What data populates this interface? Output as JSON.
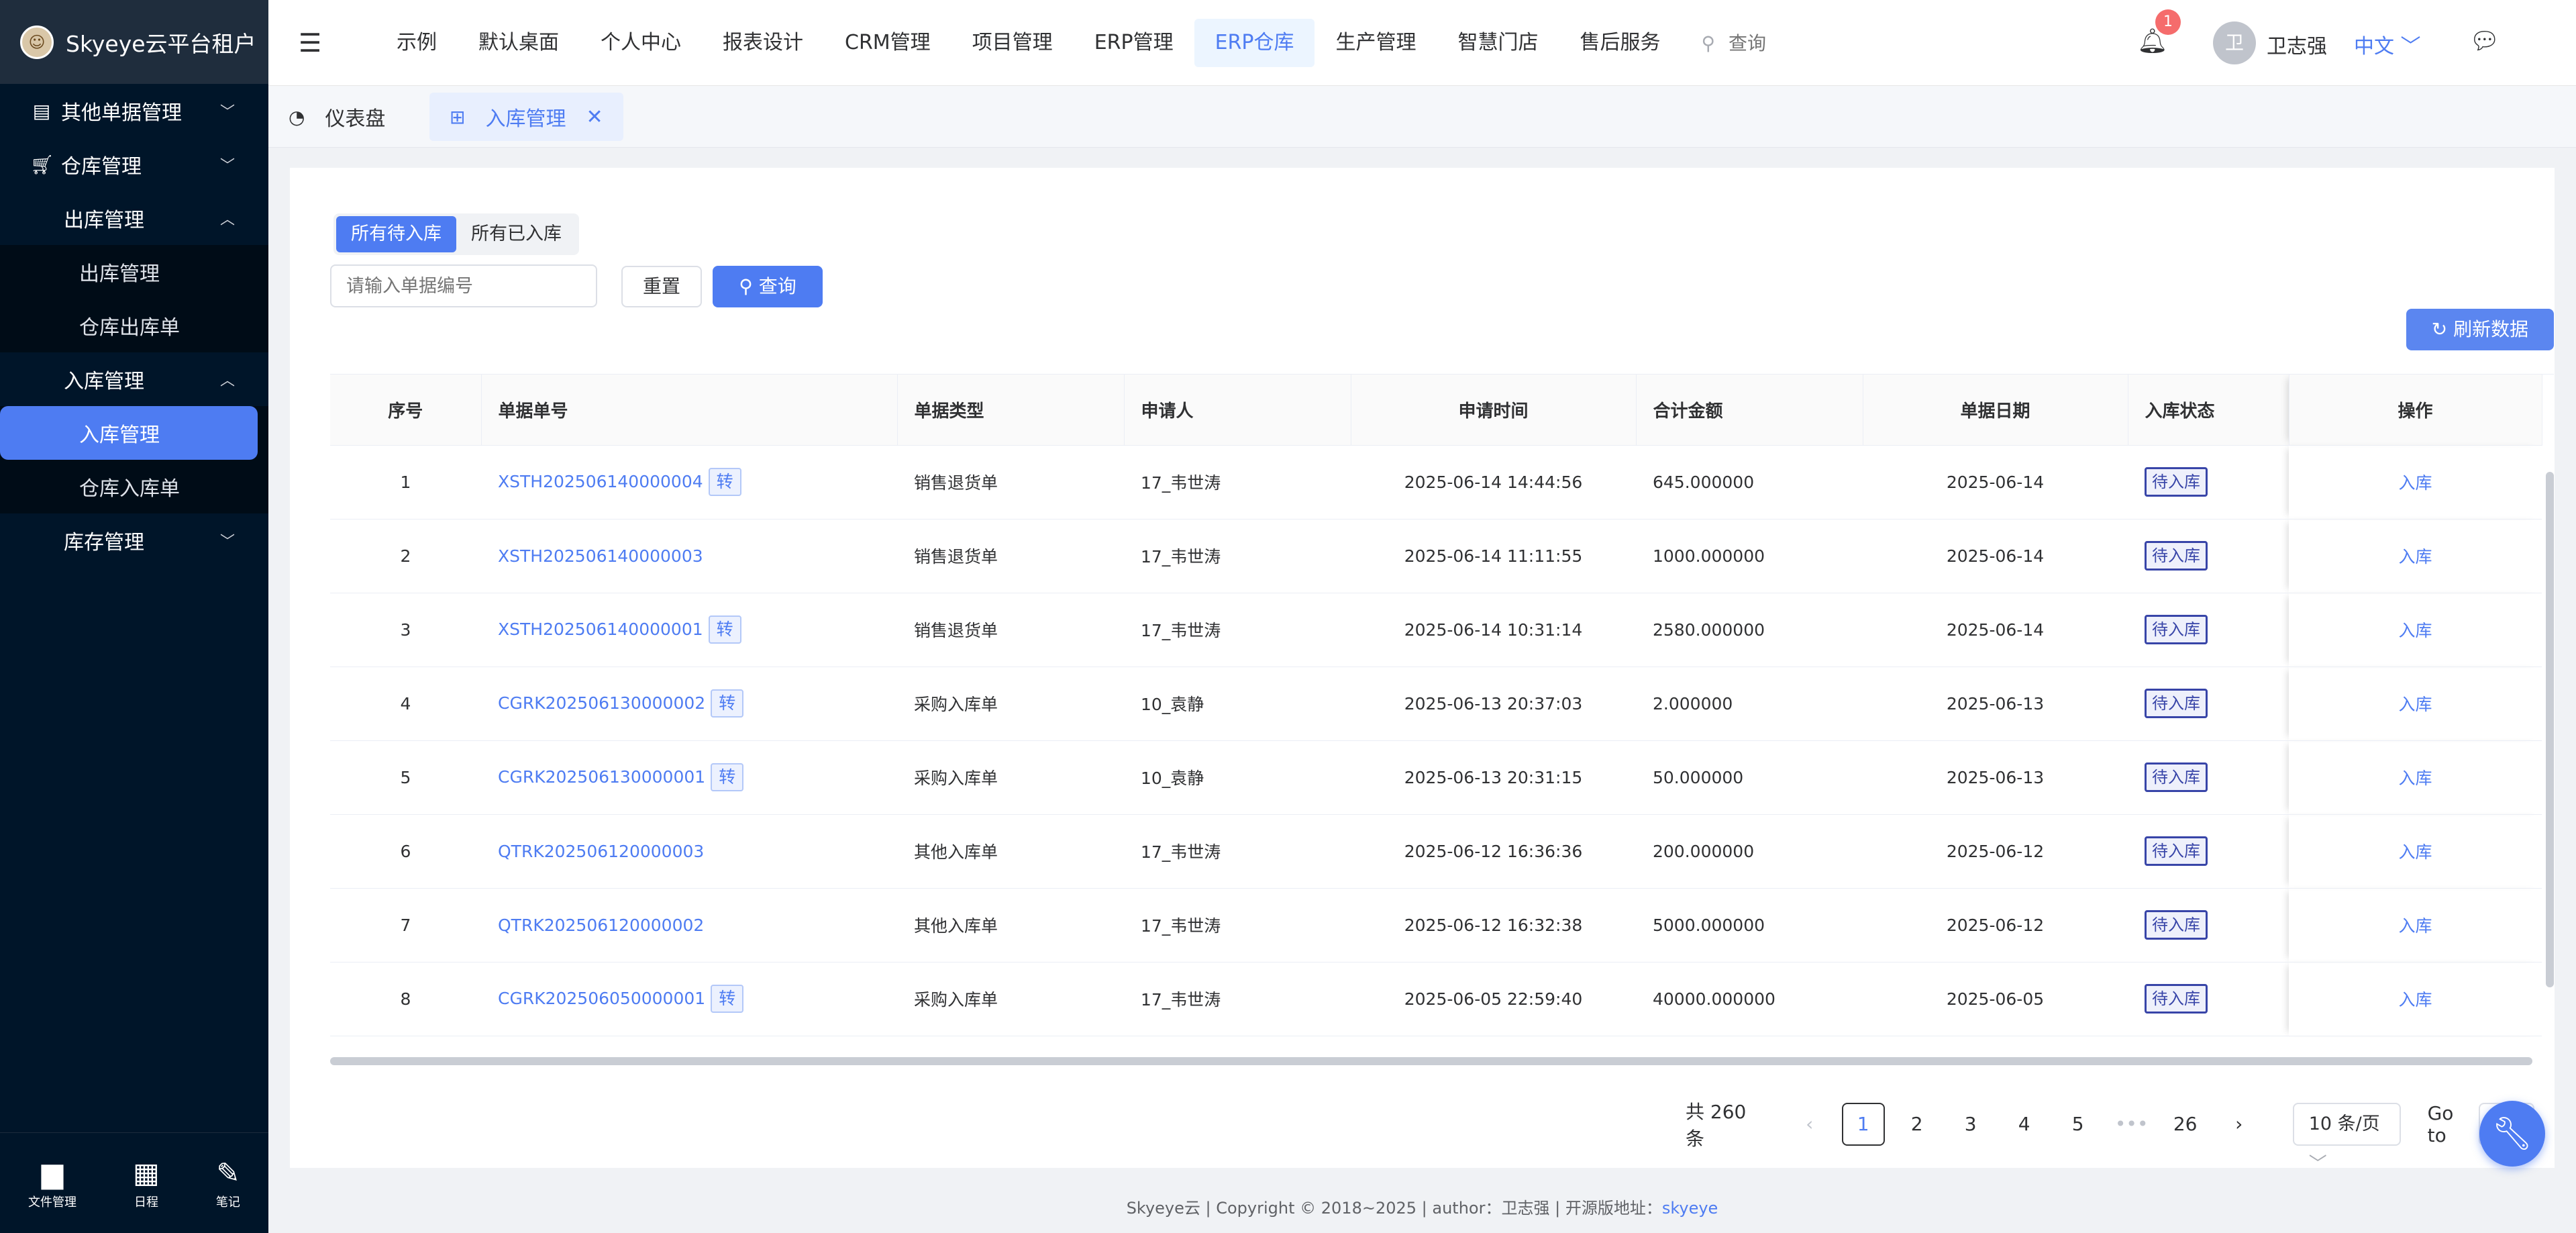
{
  "app": {
    "logo_char": "☺",
    "title": "Skyeye云平台租户"
  },
  "sidebar": {
    "items": [
      {
        "label": "其他单据管理",
        "icon": "document-icon"
      },
      {
        "label": "仓库管理",
        "icon": "cart-icon"
      },
      {
        "label": "出库管理"
      },
      {
        "label": "出库管理"
      },
      {
        "label": "仓库出库单"
      },
      {
        "label": "入库管理"
      },
      {
        "label": "入库管理"
      },
      {
        "label": "仓库入库单"
      },
      {
        "label": "库存管理"
      }
    ],
    "bottom": [
      {
        "label": "文件管理",
        "icon": "folder-icon"
      },
      {
        "label": "日程",
        "icon": "calendar-icon"
      },
      {
        "label": "笔记",
        "icon": "edit-icon"
      }
    ]
  },
  "topnav": {
    "items": [
      "示例",
      "默认桌面",
      "个人中心",
      "报表设计",
      "CRM管理",
      "项目管理",
      "ERP管理",
      "ERP仓库",
      "生产管理",
      "智慧门店",
      "售后服务"
    ],
    "search_placeholder": "查询",
    "notification_count": "1",
    "avatar_char": "卫",
    "username": "卫志强",
    "language": "中文"
  },
  "tags": {
    "dashboard": "仪表盘",
    "current": "入库管理"
  },
  "filter": {
    "tab_pending": "所有待入库",
    "tab_done": "所有已入库",
    "input_placeholder": "请输入单据编号",
    "reset": "重置",
    "query": "查询",
    "refresh": "刷新数据"
  },
  "table": {
    "headers": [
      "序号",
      "单据单号",
      "单据类型",
      "申请人",
      "申请时间",
      "合计金额",
      "单据日期",
      "入库状态",
      "操作"
    ],
    "tag_label": "转",
    "op_label": "入库",
    "rows": [
      {
        "no": "1",
        "code": "XSTH202506140000004",
        "zhuan": true,
        "type": "销售退货单",
        "applicant": "17_韦世涛",
        "time": "2025-06-14 14:44:56",
        "amount": "645.000000",
        "date": "2025-06-14",
        "status": "待入库"
      },
      {
        "no": "2",
        "code": "XSTH202506140000003",
        "zhuan": false,
        "type": "销售退货单",
        "applicant": "17_韦世涛",
        "time": "2025-06-14 11:11:55",
        "amount": "1000.000000",
        "date": "2025-06-14",
        "status": "待入库"
      },
      {
        "no": "3",
        "code": "XSTH202506140000001",
        "zhuan": true,
        "type": "销售退货单",
        "applicant": "17_韦世涛",
        "time": "2025-06-14 10:31:14",
        "amount": "2580.000000",
        "date": "2025-06-14",
        "status": "待入库"
      },
      {
        "no": "4",
        "code": "CGRK202506130000002",
        "zhuan": true,
        "type": "采购入库单",
        "applicant": "10_袁静",
        "time": "2025-06-13 20:37:03",
        "amount": "2.000000",
        "date": "2025-06-13",
        "status": "待入库"
      },
      {
        "no": "5",
        "code": "CGRK202506130000001",
        "zhuan": true,
        "type": "采购入库单",
        "applicant": "10_袁静",
        "time": "2025-06-13 20:31:15",
        "amount": "50.000000",
        "date": "2025-06-13",
        "status": "待入库"
      },
      {
        "no": "6",
        "code": "QTRK202506120000003",
        "zhuan": false,
        "type": "其他入库单",
        "applicant": "17_韦世涛",
        "time": "2025-06-12 16:36:36",
        "amount": "200.000000",
        "date": "2025-06-12",
        "status": "待入库"
      },
      {
        "no": "7",
        "code": "QTRK202506120000002",
        "zhuan": false,
        "type": "其他入库单",
        "applicant": "17_韦世涛",
        "time": "2025-06-12 16:32:38",
        "amount": "5000.000000",
        "date": "2025-06-12",
        "status": "待入库"
      },
      {
        "no": "8",
        "code": "CGRK202506050000001",
        "zhuan": true,
        "type": "采购入库单",
        "applicant": "17_韦世涛",
        "time": "2025-06-05 22:59:40",
        "amount": "40000.000000",
        "date": "2025-06-05",
        "status": "待入库"
      }
    ]
  },
  "pagination": {
    "total": "共 260 条",
    "pages": [
      "1",
      "2",
      "3",
      "4",
      "5",
      "•••",
      "26"
    ],
    "current": "1",
    "page_size": "10 条/页",
    "goto": "Go to"
  },
  "footer": {
    "text": "Skyeye云 | Copyright © 2018~2025 | author：卫志强 | 开源版地址：",
    "link": "skyeye"
  },
  "colors": {
    "primary": "#4e7cf2",
    "sidebar": "#001529",
    "status_border": "#3845a8"
  }
}
